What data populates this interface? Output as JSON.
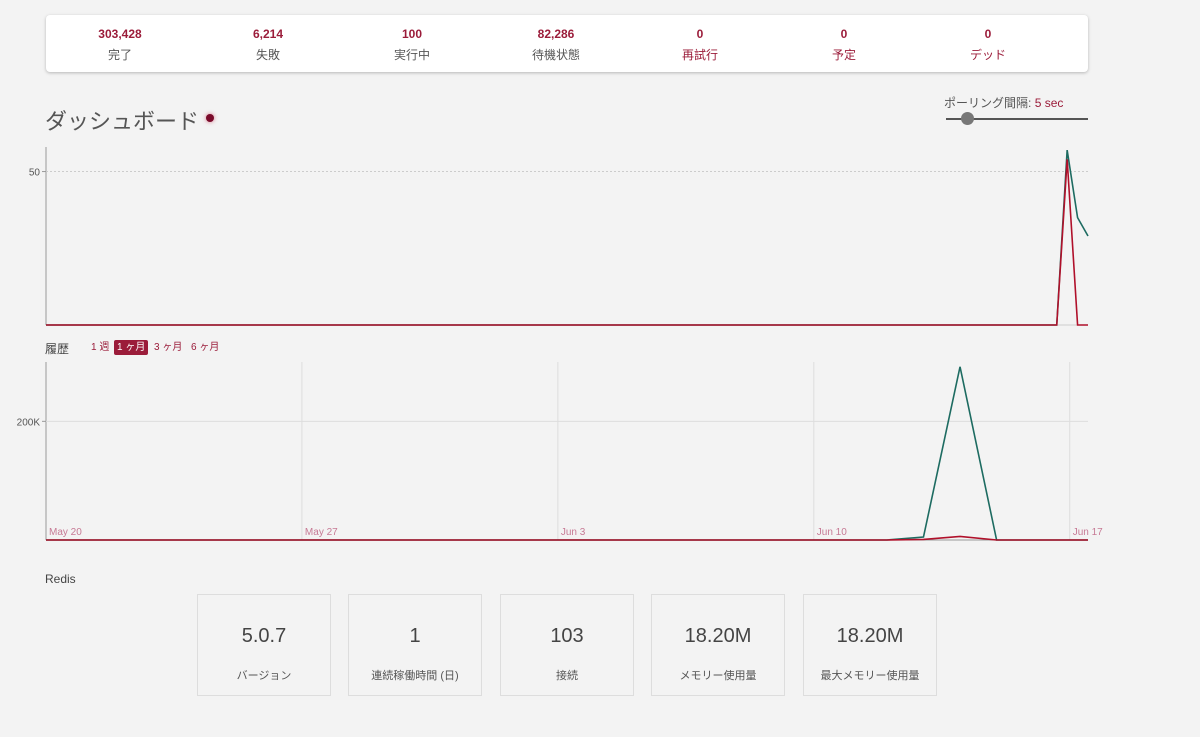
{
  "summary": [
    {
      "value": "303,428",
      "label": "完了",
      "accent": false
    },
    {
      "value": "6,214",
      "label": "失敗",
      "accent": false
    },
    {
      "value": "100",
      "label": "実行中",
      "accent": false
    },
    {
      "value": "82,286",
      "label": "待機状態",
      "accent": false
    },
    {
      "value": "0",
      "label": "再試行",
      "accent": true
    },
    {
      "value": "0",
      "label": "予定",
      "accent": true
    },
    {
      "value": "0",
      "label": "デッド",
      "accent": true
    }
  ],
  "dashboard": {
    "title": "ダッシュボード",
    "polling_label": "ポーリング間隔:",
    "polling_value": "5 sec",
    "polling_fraction": 0.15
  },
  "history": {
    "label": "履歴",
    "ranges": [
      "1 週",
      "1 ヶ月",
      "3 ヶ月",
      "6 ヶ月"
    ],
    "active_range": "1 ヶ月"
  },
  "redis": {
    "label": "Redis",
    "cards": [
      {
        "value": "5.0.7",
        "label": "バージョン"
      },
      {
        "value": "1",
        "label": "連続稼働時間 (日)"
      },
      {
        "value": "103",
        "label": "接続"
      },
      {
        "value": "18.20M",
        "label": "メモリー使用量"
      },
      {
        "value": "18.20M",
        "label": "最大メモリー使用量"
      }
    ]
  },
  "colors": {
    "accent": "#9b1c3a",
    "processed_line": "#1d6b61",
    "failed_line": "#b0102a"
  },
  "chart_data": [
    {
      "type": "line",
      "name": "realtime",
      "x": [
        0,
        1,
        2,
        3,
        4,
        5,
        6,
        7,
        8,
        9,
        10,
        11,
        12,
        13,
        14,
        15,
        16,
        17,
        18,
        19,
        20,
        21,
        22,
        23,
        24,
        25,
        26,
        27,
        28,
        29,
        30,
        31,
        32,
        33,
        34,
        35,
        36,
        37,
        38,
        39,
        40,
        41,
        42,
        43,
        44,
        45,
        46,
        47,
        48,
        49,
        50,
        51,
        52,
        53,
        54,
        55,
        56,
        57,
        58,
        59,
        60,
        61,
        62,
        63,
        64,
        65,
        66,
        67,
        68,
        69,
        70,
        71,
        72,
        73,
        74,
        75,
        76,
        77,
        78,
        79,
        80,
        81,
        82,
        83,
        84,
        85,
        86,
        87,
        88,
        89,
        90,
        91,
        92,
        93,
        94,
        95,
        96,
        97,
        98,
        99,
        100
      ],
      "series": [
        {
          "values": [
            0,
            0,
            0,
            0,
            0,
            0,
            0,
            0,
            0,
            0,
            0,
            0,
            0,
            0,
            0,
            0,
            0,
            0,
            0,
            0,
            0,
            0,
            0,
            0,
            0,
            0,
            0,
            0,
            0,
            0,
            0,
            0,
            0,
            0,
            0,
            0,
            0,
            0,
            0,
            0,
            0,
            0,
            0,
            0,
            0,
            0,
            0,
            0,
            0,
            0,
            0,
            0,
            0,
            0,
            0,
            0,
            0,
            0,
            0,
            0,
            0,
            0,
            0,
            0,
            0,
            0,
            0,
            0,
            0,
            0,
            0,
            0,
            0,
            0,
            0,
            0,
            0,
            0,
            0,
            0,
            0,
            0,
            0,
            0,
            0,
            0,
            0,
            0,
            0,
            0,
            0,
            0,
            0,
            0,
            0,
            0,
            0,
            0,
            57,
            35,
            29
          ],
          "color": "#1d6b61"
        },
        {
          "values": [
            0,
            0,
            0,
            0,
            0,
            0,
            0,
            0,
            0,
            0,
            0,
            0,
            0,
            0,
            0,
            0,
            0,
            0,
            0,
            0,
            0,
            0,
            0,
            0,
            0,
            0,
            0,
            0,
            0,
            0,
            0,
            0,
            0,
            0,
            0,
            0,
            0,
            0,
            0,
            0,
            0,
            0,
            0,
            0,
            0,
            0,
            0,
            0,
            0,
            0,
            0,
            0,
            0,
            0,
            0,
            0,
            0,
            0,
            0,
            0,
            0,
            0,
            0,
            0,
            0,
            0,
            0,
            0,
            0,
            0,
            0,
            0,
            0,
            0,
            0,
            0,
            0,
            0,
            0,
            0,
            0,
            0,
            0,
            0,
            0,
            0,
            0,
            0,
            0,
            0,
            0,
            0,
            0,
            0,
            0,
            0,
            0,
            0,
            54,
            0,
            0
          ],
          "color": "#b0102a"
        }
      ],
      "ylim": [
        0,
        58
      ],
      "yticks": [
        {
          "value": 50,
          "label": "50"
        }
      ]
    },
    {
      "type": "line",
      "name": "history",
      "x_labels": [
        "May 20",
        "May 27",
        "Jun 3",
        "Jun 10",
        "Jun 17"
      ],
      "x_day_range": [
        0,
        28.5
      ],
      "series": [
        {
          "points": [
            [
              0,
              0
            ],
            [
              23,
              0
            ],
            [
              24,
              5000
            ],
            [
              25,
              292000
            ],
            [
              26,
              0
            ],
            [
              28.5,
              0
            ]
          ],
          "color": "#1d6b61"
        },
        {
          "points": [
            [
              0,
              0
            ],
            [
              23,
              0
            ],
            [
              24,
              1000
            ],
            [
              25,
              6000
            ],
            [
              26,
              0
            ],
            [
              28.5,
              0
            ]
          ],
          "color": "#b0102a"
        }
      ],
      "ylim": [
        0,
        300000
      ],
      "yticks": [
        {
          "value": 200000,
          "label": "200K"
        }
      ]
    }
  ]
}
